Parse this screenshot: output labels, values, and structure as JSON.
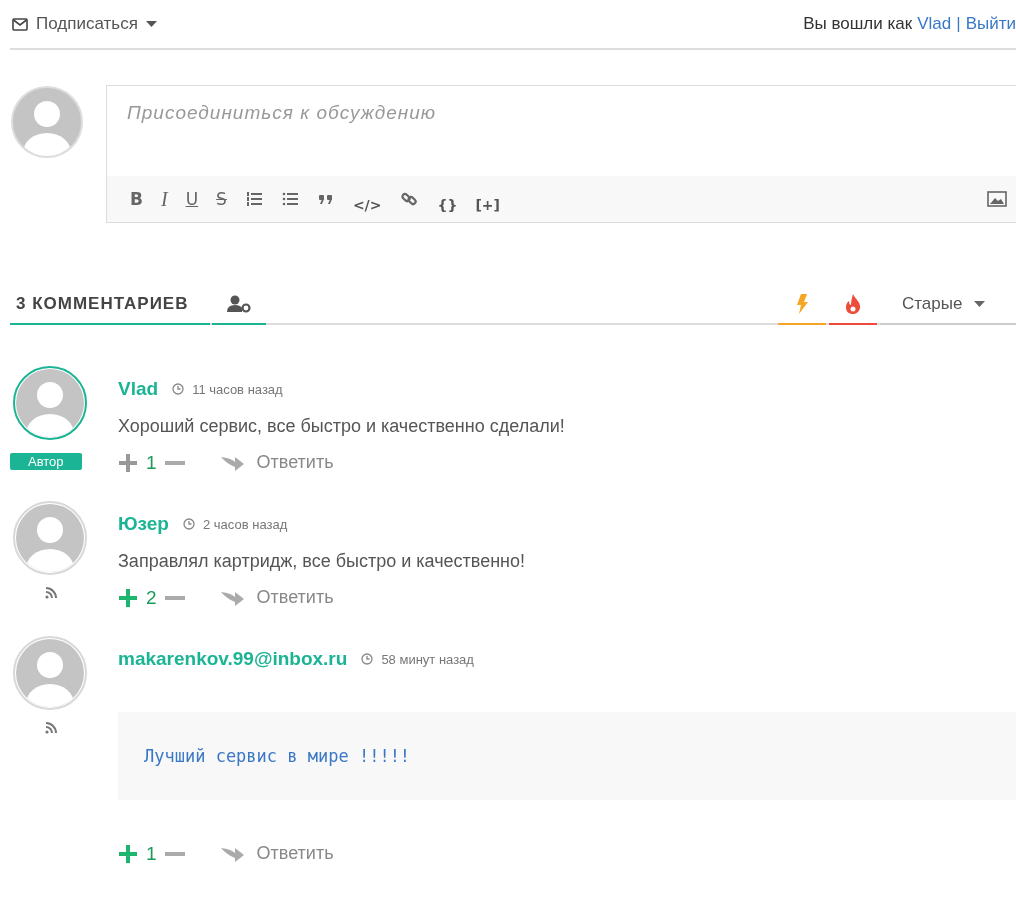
{
  "header": {
    "subscribe": "Подписаться",
    "logged_in_as": "Вы вошли как",
    "user": "Vlad",
    "separator": "|",
    "logout": "Выйти"
  },
  "editor": {
    "placeholder": "Присоединиться к обсуждению",
    "toolbar": [
      {
        "kind": "bold",
        "label": "B"
      },
      {
        "kind": "italic",
        "label": "I"
      },
      {
        "kind": "underline",
        "label": "U"
      },
      {
        "kind": "strike",
        "label": "S"
      },
      {
        "kind": "ordered-list"
      },
      {
        "kind": "bullet-list"
      },
      {
        "kind": "quote"
      },
      {
        "kind": "text",
        "label": "</>"
      },
      {
        "kind": "link"
      },
      {
        "kind": "text",
        "label": "{}"
      },
      {
        "kind": "text",
        "label": "[+]"
      }
    ]
  },
  "tabs": {
    "count": "3 КОММЕНТАРИЕВ",
    "sort": "Старые"
  },
  "comments": [
    {
      "author": "Vlad",
      "time": "11 часов назад",
      "is_author": true,
      "badge": "Автор",
      "kind": "text",
      "text": "Хороший сервис, все быстро и качественно сделали!",
      "votes": "1",
      "upvoted": false,
      "reply": "Ответить"
    },
    {
      "author": "Юзер",
      "time": "2 часов назад",
      "is_author": false,
      "kind": "text",
      "text": "Заправлял картридж, все быстро и качественно!",
      "votes": "2",
      "upvoted": true,
      "reply": "Ответить"
    },
    {
      "author": "makarenkov.99@inbox.ru",
      "time": "58 минут назад",
      "is_author": false,
      "kind": "code",
      "text": "Лучший сервис в мире !!!!!",
      "votes": "1",
      "upvoted": true,
      "reply": "Ответить"
    }
  ]
}
